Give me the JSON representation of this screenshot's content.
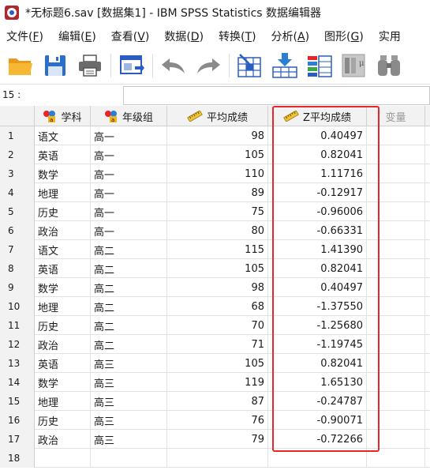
{
  "window": {
    "title": "*无标题6.sav [数据集1] - IBM SPSS Statistics 数据编辑器"
  },
  "menu": [
    {
      "label": "文件",
      "key": "F"
    },
    {
      "label": "编辑",
      "key": "E"
    },
    {
      "label": "查看",
      "key": "V"
    },
    {
      "label": "数据",
      "key": "D"
    },
    {
      "label": "转换",
      "key": "T"
    },
    {
      "label": "分析",
      "key": "A"
    },
    {
      "label": "图形",
      "key": "G"
    },
    {
      "label": "实用",
      "key": ""
    }
  ],
  "toolbar": {
    "icons": [
      "open-folder-icon",
      "save-icon",
      "print-icon",
      "dialog-recall-icon",
      "undo-icon",
      "redo-icon",
      "goto-case-icon",
      "goto-variable-icon",
      "variables-icon",
      "run-descriptive-icon",
      "find-icon"
    ]
  },
  "cellbar": {
    "ref": "15 :",
    "value": ""
  },
  "columns": [
    {
      "label": "学科",
      "type": "nominal"
    },
    {
      "label": "年级组",
      "type": "nominal"
    },
    {
      "label": "平均成绩",
      "type": "scale"
    },
    {
      "label": "Z平均成绩",
      "type": "scale"
    },
    {
      "label": "变量",
      "type": "empty"
    }
  ],
  "rows": [
    {
      "n": "1",
      "subject": "语文",
      "grade": "高一",
      "score": "98",
      "z": "0.40497"
    },
    {
      "n": "2",
      "subject": "英语",
      "grade": "高一",
      "score": "105",
      "z": "0.82041"
    },
    {
      "n": "3",
      "subject": "数学",
      "grade": "高一",
      "score": "110",
      "z": "1.11716"
    },
    {
      "n": "4",
      "subject": "地理",
      "grade": "高一",
      "score": "89",
      "z": "-0.12917"
    },
    {
      "n": "5",
      "subject": "历史",
      "grade": "高一",
      "score": "75",
      "z": "-0.96006"
    },
    {
      "n": "6",
      "subject": "政治",
      "grade": "高一",
      "score": "80",
      "z": "-0.66331"
    },
    {
      "n": "7",
      "subject": "语文",
      "grade": "高二",
      "score": "115",
      "z": "1.41390"
    },
    {
      "n": "8",
      "subject": "英语",
      "grade": "高二",
      "score": "105",
      "z": "0.82041"
    },
    {
      "n": "9",
      "subject": "数学",
      "grade": "高二",
      "score": "98",
      "z": "0.40497"
    },
    {
      "n": "10",
      "subject": "地理",
      "grade": "高二",
      "score": "68",
      "z": "-1.37550"
    },
    {
      "n": "11",
      "subject": "历史",
      "grade": "高二",
      "score": "70",
      "z": "-1.25680"
    },
    {
      "n": "12",
      "subject": "政治",
      "grade": "高二",
      "score": "71",
      "z": "-1.19745"
    },
    {
      "n": "13",
      "subject": "英语",
      "grade": "高三",
      "score": "105",
      "z": "0.82041"
    },
    {
      "n": "14",
      "subject": "数学",
      "grade": "高三",
      "score": "119",
      "z": "1.65130"
    },
    {
      "n": "15",
      "subject": "地理",
      "grade": "高三",
      "score": "87",
      "z": "-0.24787"
    },
    {
      "n": "16",
      "subject": "历史",
      "grade": "高三",
      "score": "76",
      "z": "-0.90071"
    },
    {
      "n": "17",
      "subject": "政治",
      "grade": "高三",
      "score": "79",
      "z": "-0.72266"
    },
    {
      "n": "18",
      "subject": "",
      "grade": "",
      "score": "",
      "z": ""
    }
  ],
  "colors": {
    "highlight": "#e8262a",
    "header_bg": "#f2f2f2"
  }
}
